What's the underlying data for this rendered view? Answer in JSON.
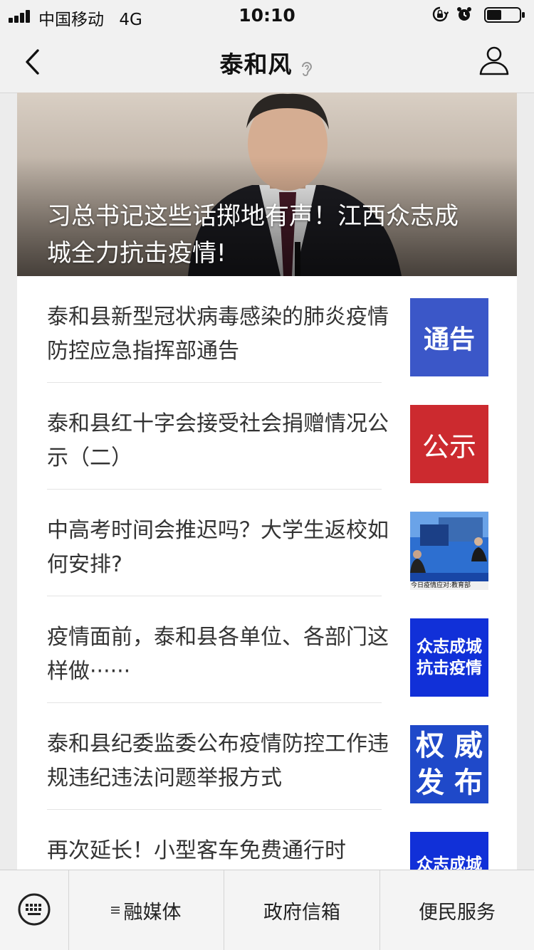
{
  "status_bar": {
    "carrier": "中国移动",
    "network": "4G",
    "time": "10:10"
  },
  "nav": {
    "title": "泰和风",
    "back_icon": "chevron-left-icon",
    "profile_icon": "person-icon"
  },
  "hero": {
    "title": "习总书记这些话掷地有声！江西众志成城全力抗击疫情!"
  },
  "news": [
    {
      "title": "泰和县新型冠状病毒感染的肺炎疫情防控应急指挥部通告",
      "thumb": {
        "type": "text",
        "text": "通告",
        "bg": "#3b57c8"
      }
    },
    {
      "title": "泰和县红十字会接受社会捐赠情况公示（二）",
      "thumb": {
        "type": "text",
        "text": "公示",
        "bg": "#cc2a2f"
      }
    },
    {
      "title": "中高考时间会推迟吗？大学生返校如何安排?",
      "thumb": {
        "type": "image",
        "caption": "今日疫情应对:教育部"
      }
    },
    {
      "title": "疫情面前，泰和县各单位、各部门这样做······",
      "thumb": {
        "type": "text",
        "lines": [
          "众志成城",
          "抗击疫情"
        ],
        "bg": "#1130d8"
      }
    },
    {
      "title": "泰和县纪委监委公布疫情防控工作违规违纪违法问题举报方式",
      "thumb": {
        "type": "text",
        "lines": [
          "权 威",
          "发 布"
        ],
        "bg": "#1f49c9"
      }
    },
    {
      "title": "再次延长！小型客车免费通行时",
      "thumb": {
        "type": "text",
        "lines": [
          "众志成城"
        ],
        "bg": "#1130d8"
      }
    }
  ],
  "tab_bar": {
    "keyboard_icon": "keyboard-icon",
    "tabs": [
      "融媒体",
      "政府信箱",
      "便民服务"
    ]
  }
}
